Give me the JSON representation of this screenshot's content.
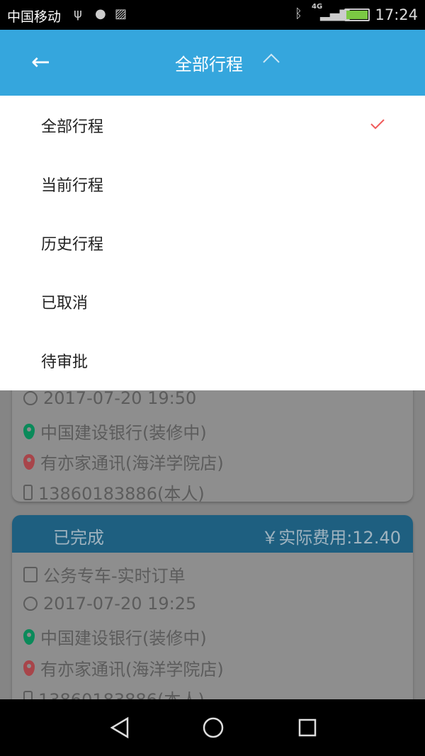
{
  "status_bar": {
    "carrier": "中国移动",
    "network": "4G",
    "time": "17:24",
    "icons": [
      "usb-icon",
      "android-icon",
      "image-icon",
      "bluetooth-icon",
      "signal-icon",
      "battery-charging-icon"
    ]
  },
  "app_bar": {
    "title": "全部行程",
    "back_icon": "arrow-left-icon",
    "toggle_icon": "chevron-up-icon",
    "color": "#35a6dd"
  },
  "filter_menu": {
    "items": [
      {
        "label": "全部行程",
        "selected": true
      },
      {
        "label": "当前行程"
      },
      {
        "label": "历史行程"
      },
      {
        "label": "已取消"
      },
      {
        "label": "待审批"
      }
    ],
    "check_color": "#f05a5a"
  },
  "trips": [
    {
      "time": "2017-07-20 19:50",
      "origin": "中国建设银行(装修中)",
      "destination": "有亦家通讯(海洋学院店)",
      "phone": "13860183886(本人)"
    },
    {
      "status": "已完成",
      "fee": "￥实际费用:12.40",
      "type": "公务专车-实时订单",
      "time": "2017-07-20 19:25",
      "origin": "中国建设银行(装修中)",
      "destination": "有亦家通讯(海洋学院店)",
      "phone": "13860183886(本人)"
    }
  ]
}
